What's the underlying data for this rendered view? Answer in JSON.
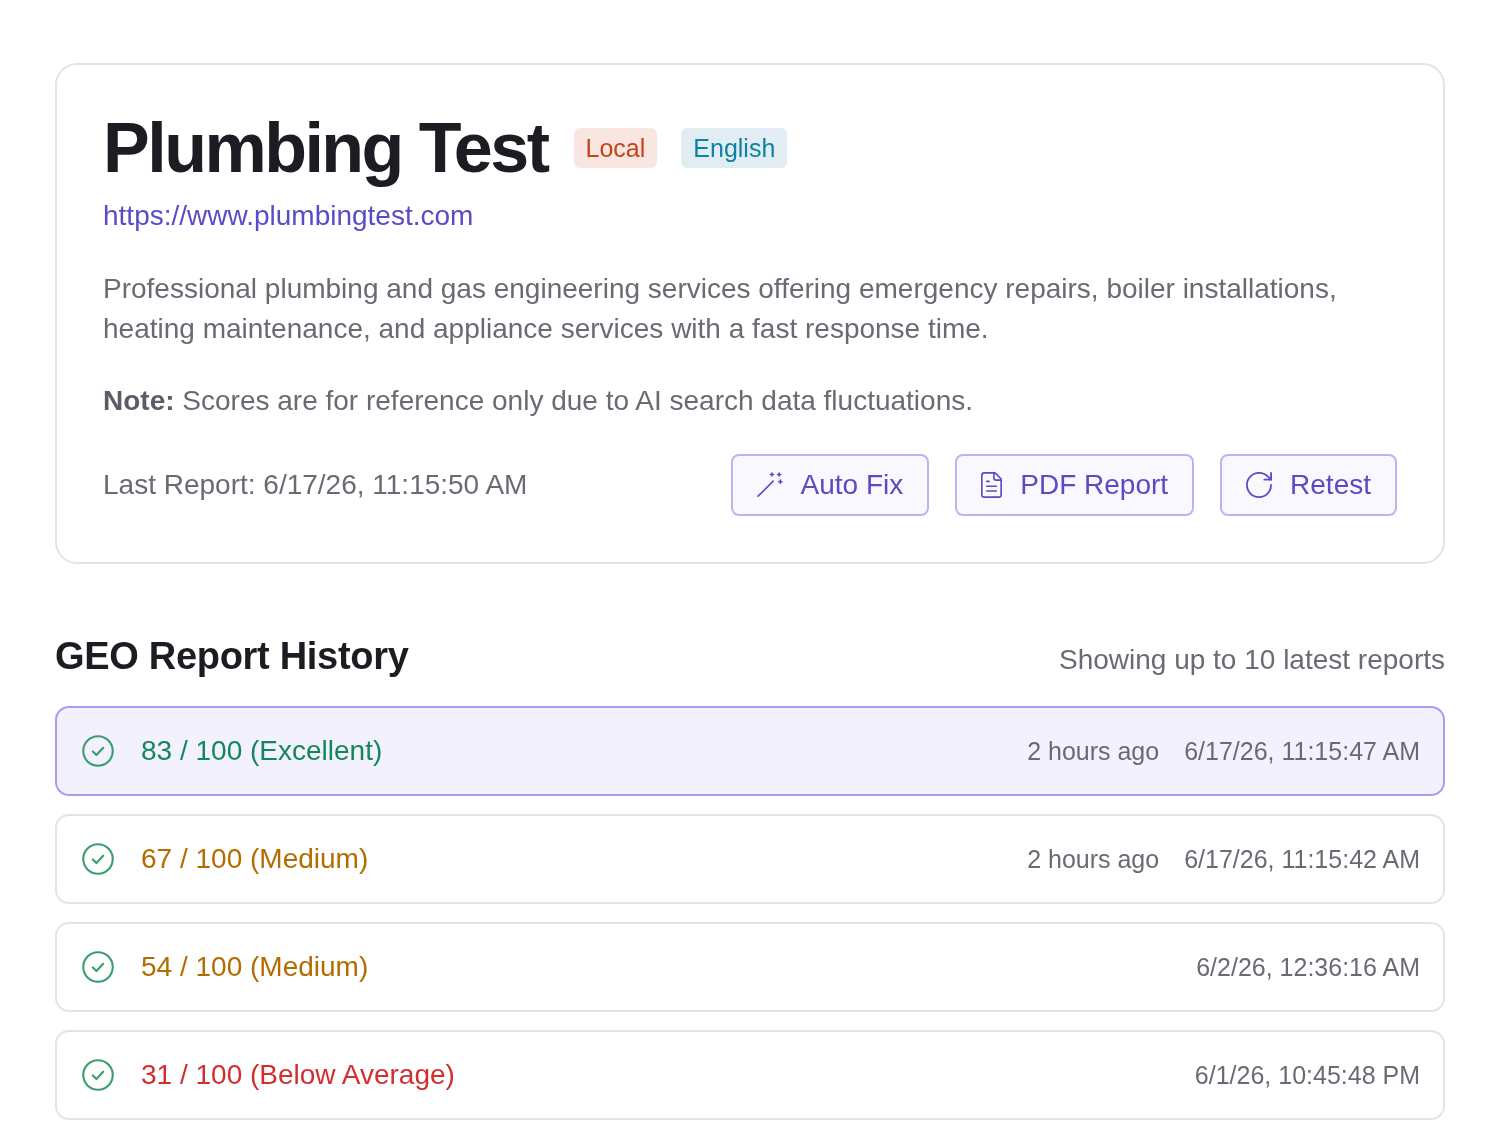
{
  "site": {
    "title": "Plumbing Test",
    "badges": [
      {
        "label": "Local",
        "color": "#c6431a"
      },
      {
        "label": "English",
        "color": "#0e82a2"
      }
    ],
    "url": "https://www.plumbingtest.com",
    "description": "Professional plumbing and gas engineering services offering emergency repairs, boiler installations, heating maintenance, and appliance services with a fast response time.",
    "note": "**Note:** Scores are for reference only due to AI search data fluctuations.",
    "last_report": "Last Report: 6/17/26, 11:15:50 AM",
    "actions": [
      {
        "kind": "auto_fix",
        "label": "Auto Fix"
      },
      {
        "kind": "pdf_report",
        "label": "PDF Report"
      },
      {
        "kind": "retest",
        "label": "Retest"
      }
    ]
  },
  "history": {
    "title": "GEO Report History",
    "caption": "Showing up to 10 latest reports",
    "reports": [
      {
        "completed": true,
        "score": "83 / 100 (Excellent)",
        "color": "#13875c",
        "relative_time": "2 hours ago",
        "date": "6/17/26, 11:15:47 AM",
        "selected": true
      },
      {
        "completed": true,
        "score": "67 / 100 (Medium)",
        "color": "#b46c00",
        "relative_time": "2 hours ago",
        "date": "6/17/26, 11:15:42 AM",
        "selected": false
      },
      {
        "completed": true,
        "score": "54 / 100 (Medium)",
        "color": "#b46c00",
        "date": "6/2/26, 12:36:16 AM",
        "selected": false
      },
      {
        "completed": true,
        "score": "31 / 100 (Below Average)",
        "color": "#d12f2f",
        "date": "6/1/26, 10:45:48 PM",
        "selected": false
      }
    ]
  }
}
